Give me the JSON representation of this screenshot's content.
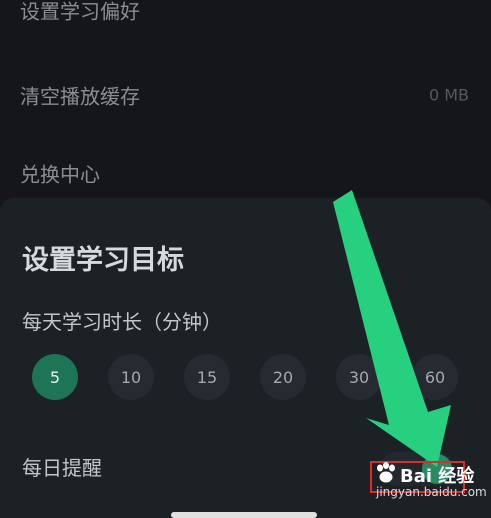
{
  "settings": {
    "items": [
      {
        "label": "设置学习偏好",
        "value": ""
      },
      {
        "label": "清空播放缓存",
        "value": "0 MB"
      },
      {
        "label": "兑换中心",
        "value": ""
      }
    ]
  },
  "sheet": {
    "title": "设置学习目标",
    "duration_label": "每天学习时长（分钟）",
    "durations": [
      "5",
      "10",
      "15",
      "20",
      "30",
      "60"
    ],
    "selected_duration": "5",
    "reminder_label": "每日提醒",
    "reminder_on": true
  },
  "watermark": {
    "logo": "Bai 经验",
    "url": "jingyan.baidu.com"
  },
  "colors": {
    "accent": "#1d7457",
    "arrow": "#27d07f",
    "highlight": "#e02a2a"
  }
}
